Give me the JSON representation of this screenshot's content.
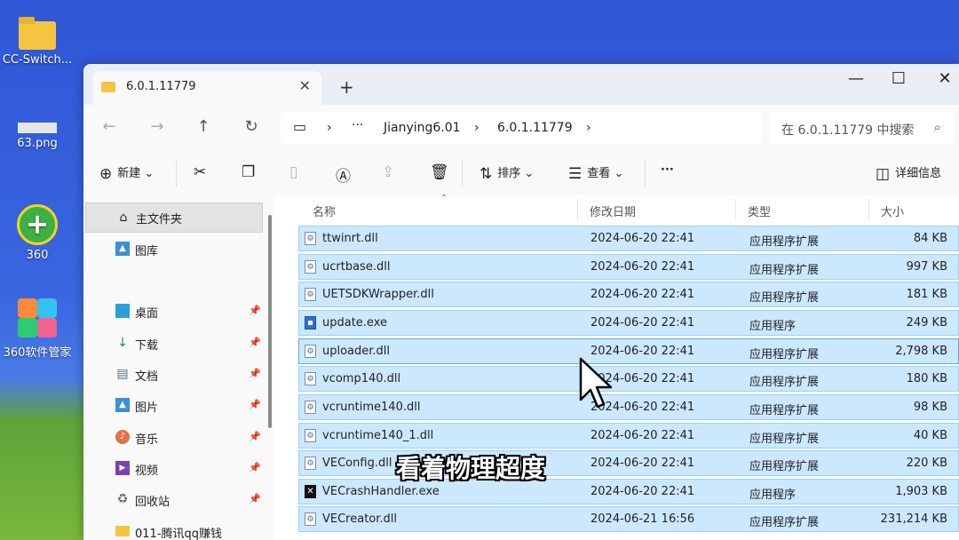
{
  "desktop": {
    "icons": [
      {
        "label": "CC-Switch..."
      },
      {
        "label": "63.png"
      },
      {
        "label": "360"
      },
      {
        "label": "360软件管家"
      }
    ]
  },
  "window": {
    "tab_title": "6.0.1.11779",
    "tab_close": "✕",
    "new_tab": "+",
    "controls": {
      "minimize": "—",
      "maximize": "☐",
      "close": "✕"
    },
    "address": {
      "sep": "›",
      "more": "···",
      "segments": [
        "Jianying6.01",
        "6.0.1.11779"
      ]
    },
    "search_placeholder": "在 6.0.1.11779 中搜索",
    "toolbar": {
      "new": "新建",
      "sort": "排序",
      "view": "查看",
      "more": "···",
      "details": "详细信息"
    },
    "sidebar": {
      "items": [
        {
          "label": "主文件夹",
          "icon": "home-icon"
        },
        {
          "label": "图库",
          "icon": "gallery-icon"
        },
        {
          "label": "桌面",
          "icon": "desktop-icon"
        },
        {
          "label": "下载",
          "icon": "download-icon"
        },
        {
          "label": "文档",
          "icon": "document-icon"
        },
        {
          "label": "图片",
          "icon": "pictures-icon"
        },
        {
          "label": "音乐",
          "icon": "music-icon"
        },
        {
          "label": "视频",
          "icon": "video-icon"
        },
        {
          "label": "回收站",
          "icon": "recycle-bin-icon"
        },
        {
          "label": "011-腾讯qq赚钱",
          "icon": "folder-icon"
        }
      ]
    },
    "columns": {
      "name": "名称",
      "modified": "修改日期",
      "type": "类型",
      "size": "大小"
    },
    "files": [
      {
        "name": "ttwinrt.dll",
        "date": "2024-06-20 22:41",
        "type": "应用程序扩展",
        "size": "84 KB",
        "icon": "dll"
      },
      {
        "name": "ucrtbase.dll",
        "date": "2024-06-20 22:41",
        "type": "应用程序扩展",
        "size": "997 KB",
        "icon": "dll"
      },
      {
        "name": "UETSDKWrapper.dll",
        "date": "2024-06-20 22:41",
        "type": "应用程序扩展",
        "size": "181 KB",
        "icon": "dll"
      },
      {
        "name": "update.exe",
        "date": "2024-06-20 22:41",
        "type": "应用程序",
        "size": "249 KB",
        "icon": "exe"
      },
      {
        "name": "uploader.dll",
        "date": "2024-06-20 22:41",
        "type": "应用程序扩展",
        "size": "2,798 KB",
        "icon": "dll"
      },
      {
        "name": "vcomp140.dll",
        "date": "2024-06-20 22:41",
        "type": "应用程序扩展",
        "size": "180 KB",
        "icon": "dll"
      },
      {
        "name": "vcruntime140.dll",
        "date": "2024-06-20 22:41",
        "type": "应用程序扩展",
        "size": "98 KB",
        "icon": "dll"
      },
      {
        "name": "vcruntime140_1.dll",
        "date": "2024-06-20 22:41",
        "type": "应用程序扩展",
        "size": "40 KB",
        "icon": "dll"
      },
      {
        "name": "VEConfig.dll",
        "date": "2024-06-20 22:41",
        "type": "应用程序扩展",
        "size": "220 KB",
        "icon": "dll"
      },
      {
        "name": "VECrashHandler.exe",
        "date": "2024-06-20 22:41",
        "type": "应用程序",
        "size": "1,903 KB",
        "icon": "ve"
      },
      {
        "name": "VECreator.dll",
        "date": "2024-06-21 16:56",
        "type": "应用程序扩展",
        "size": "231,214 KB",
        "icon": "dll"
      }
    ]
  },
  "overlay_subtitle": "看着物理超度",
  "colors": {
    "selection": "#cce8ff",
    "selection_border": "#99d1ff",
    "accent": "#2f6fd1"
  }
}
